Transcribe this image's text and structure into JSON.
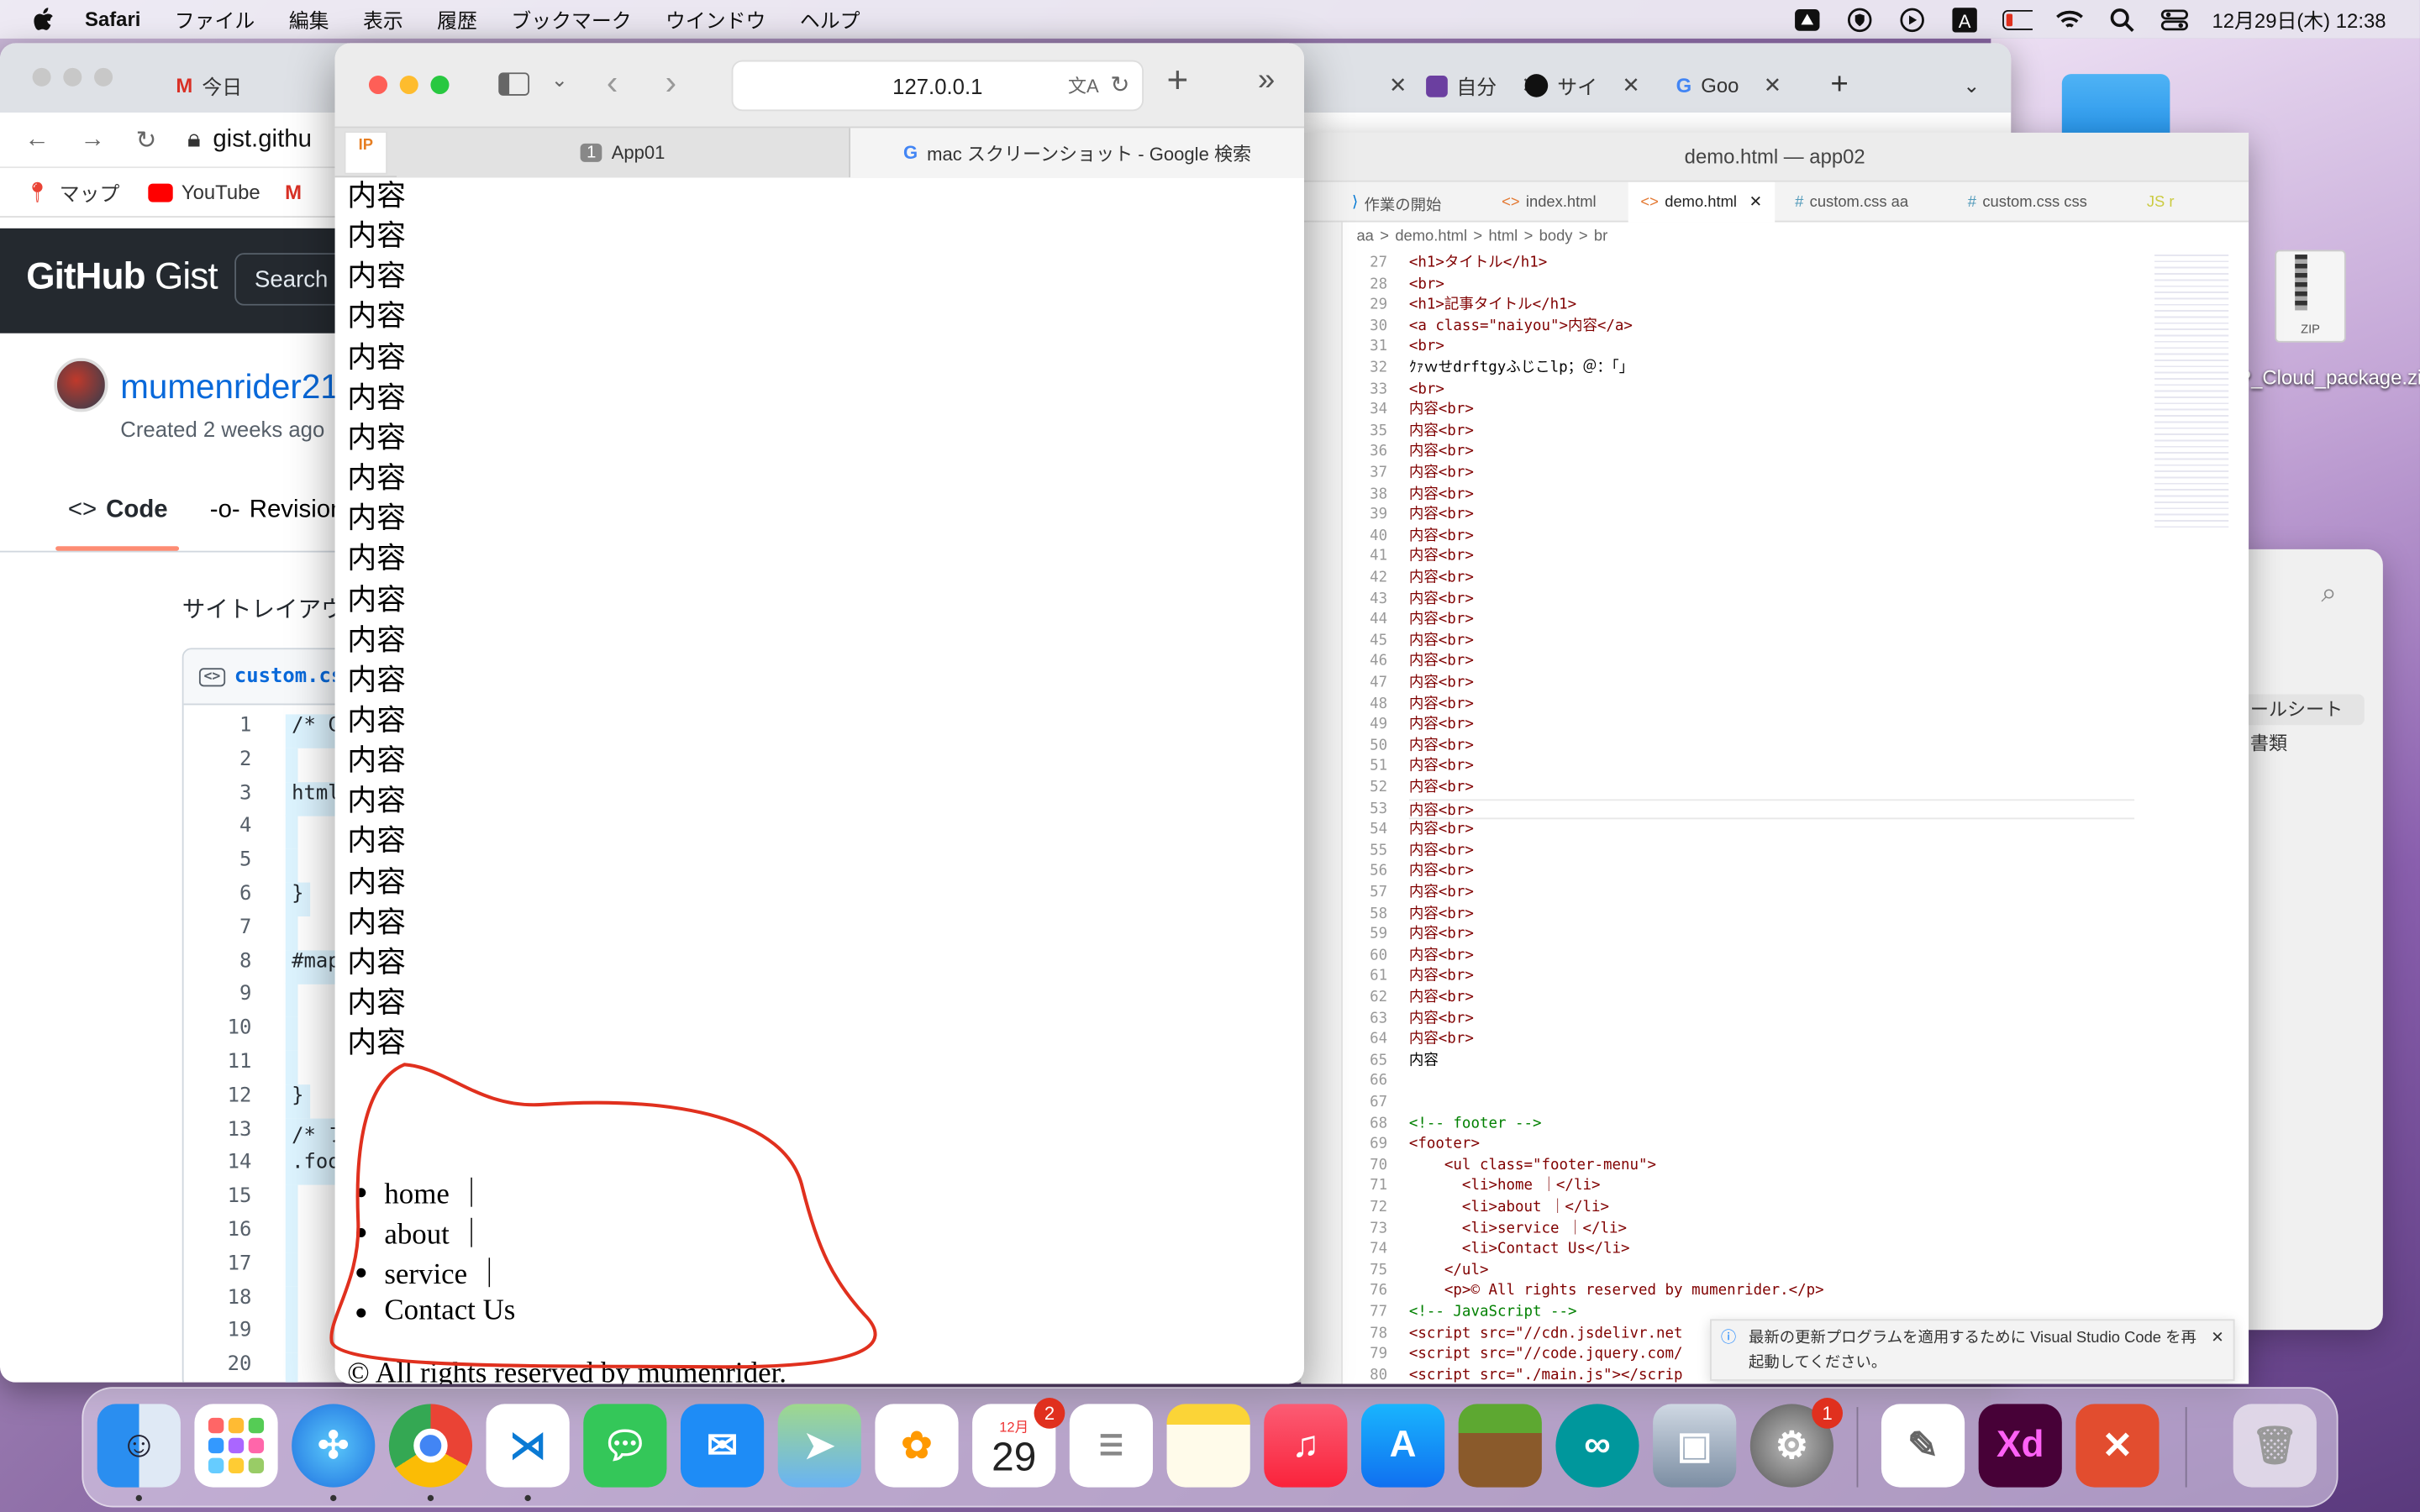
{
  "menubar": {
    "app": "Safari",
    "items": [
      "ファイル",
      "編集",
      "表示",
      "履歴",
      "ブックマーク",
      "ウインドウ",
      "ヘルプ"
    ],
    "datetime": "12月29日(木) 12:38"
  },
  "gist_window": {
    "tabs": [
      "今日",
      "自分",
      "サイ",
      "Goo"
    ],
    "url": "gist.githu",
    "bookmarks": [
      "マップ",
      "YouTube"
    ],
    "logo_bold": "GitHub",
    "logo_light": "Gist",
    "search_placeholder": "Search",
    "username": "mumenrider21",
    "created": "Created 2 weeks ago",
    "tab_code": "Code",
    "tab_revisions": "Revisions",
    "description": "サイトレイアウ",
    "file_name": "custom.cs",
    "code_lines": [
      {
        "n": "1",
        "t": "/* C"
      },
      {
        "n": "2",
        "t": ""
      },
      {
        "n": "3",
        "t": "html"
      },
      {
        "n": "4",
        "t": ""
      },
      {
        "n": "5",
        "t": ""
      },
      {
        "n": "6",
        "t": "}"
      },
      {
        "n": "7",
        "t": ""
      },
      {
        "n": "8",
        "t": "#map"
      },
      {
        "n": "9",
        "t": ""
      },
      {
        "n": "10",
        "t": ""
      },
      {
        "n": "11",
        "t": ""
      },
      {
        "n": "12",
        "t": "}"
      },
      {
        "n": "13",
        "t": "/* フ"
      },
      {
        "n": "14",
        "t": ".foo"
      },
      {
        "n": "15",
        "t": ""
      },
      {
        "n": "16",
        "t": ""
      },
      {
        "n": "17",
        "t": ""
      },
      {
        "n": "18",
        "t": ""
      },
      {
        "n": "19",
        "t": ""
      },
      {
        "n": "20",
        "t": ""
      }
    ]
  },
  "safari": {
    "url": "127.0.0.1",
    "tab1_num": "1",
    "tab1": "App01",
    "tab2": "mac スクリーンショット - Google 検索",
    "favicon_text": "IP",
    "content_word": "内容",
    "footer_menu": [
      "home ｜",
      "about ｜",
      "service ｜",
      "Contact Us"
    ],
    "copyright": "© All rights reserved by mumenrider."
  },
  "vscode": {
    "title": "demo.html — app02",
    "tabs": [
      "作業の開始",
      "index.html",
      "demo.html",
      "custom.css aa",
      "custom.css css",
      "JS r"
    ],
    "breadcrumb": [
      "aa",
      ">",
      "demo.html",
      ">",
      "html",
      ">",
      "body",
      ">",
      "br"
    ],
    "lines": [
      {
        "n": "27",
        "t": "<h1>タイトル</h1>"
      },
      {
        "n": "28",
        "t": "<br>"
      },
      {
        "n": "29",
        "t": "<h1>記事タイトル</h1>"
      },
      {
        "n": "30",
        "t": "<a class=\"naiyou\">内容</a>"
      },
      {
        "n": "31",
        "t": "<br>"
      },
      {
        "n": "32",
        "t": "ｸｧｗせdrftgyふじこlp；＠：「」"
      },
      {
        "n": "33",
        "t": "<br>"
      },
      {
        "n": "34",
        "t": "内容<br>"
      },
      {
        "n": "35",
        "t": "内容<br>"
      },
      {
        "n": "36",
        "t": "内容<br>"
      },
      {
        "n": "37",
        "t": "内容<br>"
      },
      {
        "n": "38",
        "t": "内容<br>"
      },
      {
        "n": "39",
        "t": "内容<br>"
      },
      {
        "n": "40",
        "t": "内容<br>"
      },
      {
        "n": "41",
        "t": "内容<br>"
      },
      {
        "n": "42",
        "t": "内容<br>"
      },
      {
        "n": "43",
        "t": "内容<br>"
      },
      {
        "n": "44",
        "t": "内容<br>"
      },
      {
        "n": "45",
        "t": "内容<br>"
      },
      {
        "n": "46",
        "t": "内容<br>"
      },
      {
        "n": "47",
        "t": "内容<br>"
      },
      {
        "n": "48",
        "t": "内容<br>"
      },
      {
        "n": "49",
        "t": "内容<br>"
      },
      {
        "n": "50",
        "t": "内容<br>"
      },
      {
        "n": "51",
        "t": "内容<br>"
      },
      {
        "n": "52",
        "t": "内容<br>"
      },
      {
        "n": "53",
        "t": "内容<br>"
      },
      {
        "n": "54",
        "t": "内容<br>"
      },
      {
        "n": "55",
        "t": "内容<br>"
      },
      {
        "n": "56",
        "t": "内容<br>"
      },
      {
        "n": "57",
        "t": "内容<br>"
      },
      {
        "n": "58",
        "t": "内容<br>"
      },
      {
        "n": "59",
        "t": "内容<br>"
      },
      {
        "n": "60",
        "t": "内容<br>"
      },
      {
        "n": "61",
        "t": "内容<br>"
      },
      {
        "n": "62",
        "t": "内容<br>"
      },
      {
        "n": "63",
        "t": "内容<br>"
      },
      {
        "n": "64",
        "t": "内容<br>"
      },
      {
        "n": "65",
        "t": "内容"
      },
      {
        "n": "66",
        "t": ""
      },
      {
        "n": "67",
        "t": ""
      },
      {
        "n": "68",
        "t": "<!-- footer -->"
      },
      {
        "n": "69",
        "t": "<footer>"
      },
      {
        "n": "70",
        "t": "    <ul class=\"footer-menu\">"
      },
      {
        "n": "71",
        "t": "      <li>home ｜</li>"
      },
      {
        "n": "72",
        "t": "      <li>about ｜</li>"
      },
      {
        "n": "73",
        "t": "      <li>service ｜</li>"
      },
      {
        "n": "74",
        "t": "      <li>Contact Us</li>"
      },
      {
        "n": "75",
        "t": "    </ul>"
      },
      {
        "n": "76",
        "t": "    <p>© All rights reserved by mumenrider.</p>"
      },
      {
        "n": "77",
        "t": "<!-- JavaScript -->"
      },
      {
        "n": "78",
        "t": "<script src=\"//cdn.jsdelivr.net"
      },
      {
        "n": "79",
        "t": "<script src=\"//code.jquery.com/"
      },
      {
        "n": "80",
        "t": "<script src=\"./main.js\"></scrip"
      }
    ],
    "notification": "最新の更新プログラムを適用するために Visual Studio Code を再起動してください。"
  },
  "finder": {
    "rows": [
      "ールシート",
      "書類"
    ]
  },
  "desktop": {
    "zip_label": "P_Cloud_package.zip",
    "zip_icon": "ZIP"
  },
  "dock": {
    "calendar_month": "12月",
    "calendar_day": "29",
    "calendar_badge": "2",
    "settings_badge": "1"
  },
  "colors": {
    "annotation": "#e0301e",
    "github_header": "#24292f",
    "link": "#0969da"
  }
}
